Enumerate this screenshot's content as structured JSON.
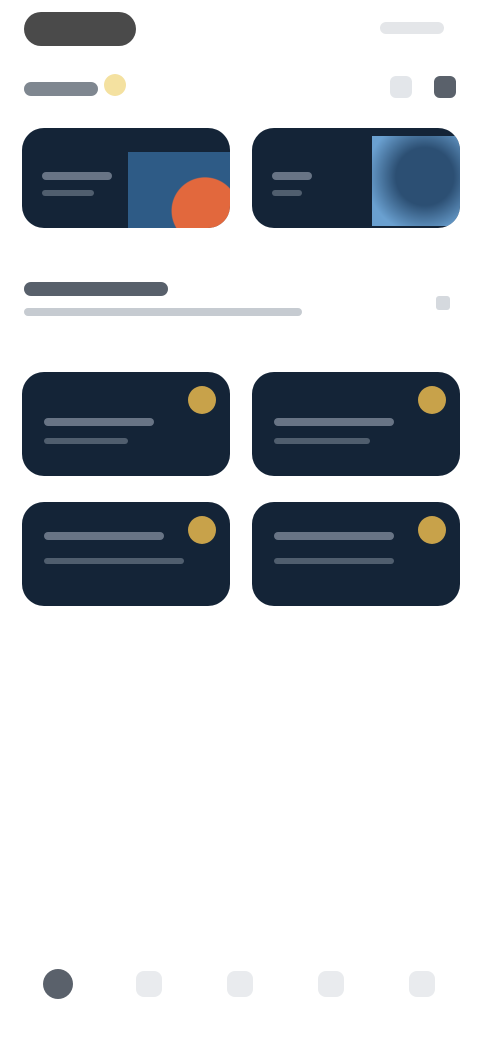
{
  "status_bar": {
    "time_pill": "",
    "system_icons": ""
  },
  "header": {
    "title": "",
    "sparkle_icon": "sparkle-icon",
    "actions": [
      {
        "name": "search-icon"
      },
      {
        "name": "notification-icon"
      }
    ]
  },
  "promo_cards": [
    {
      "title": "",
      "subtitle": ""
    },
    {
      "title": "",
      "subtitle": ""
    }
  ],
  "section": {
    "title": "",
    "subtitle": ""
  },
  "grid_cards": [
    {
      "title": "",
      "subtitle": ""
    },
    {
      "title": "",
      "subtitle": ""
    },
    {
      "title": "",
      "subtitle": ""
    },
    {
      "title": "",
      "subtitle": ""
    }
  ],
  "bottom_nav": [
    {
      "icon": "home-icon",
      "label": "",
      "active": true
    },
    {
      "icon": "explore-icon",
      "label": ""
    },
    {
      "icon": "add-icon",
      "label": ""
    },
    {
      "icon": "messages-icon",
      "label": ""
    },
    {
      "icon": "profile-icon",
      "label": ""
    }
  ],
  "colors": {
    "card_bg": "#142437",
    "accent_gold": "#c8a24a",
    "accent_orange": "#e2683d",
    "nav_active": "#5a616b"
  }
}
